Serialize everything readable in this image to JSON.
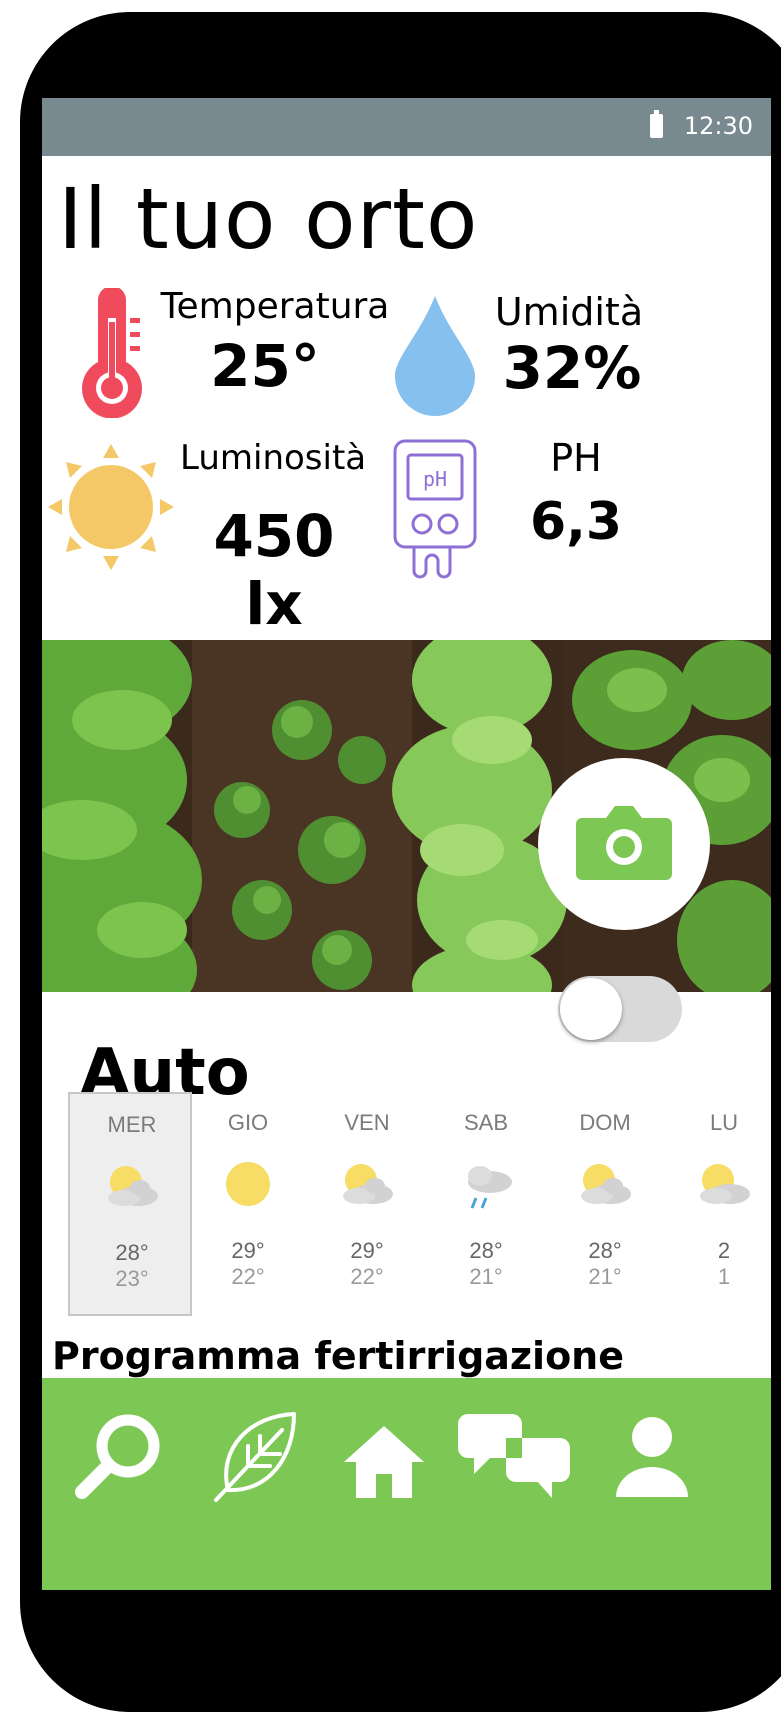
{
  "status_bar": {
    "time": "12:30"
  },
  "header": {
    "title": "Il tuo orto"
  },
  "metrics": {
    "temperature": {
      "label": "Temperatura",
      "value": "25°",
      "icon": "thermometer-icon",
      "color": "#ef4b5c"
    },
    "humidity": {
      "label": "Umidità",
      "value": "32%",
      "icon": "water-drop-icon",
      "color": "#85c0ee"
    },
    "light": {
      "label": "Luminosità",
      "value": "450 lx",
      "icon": "sun-icon",
      "color": "#f5c867"
    },
    "ph": {
      "label": "PH",
      "value": "6,3",
      "icon": "ph-meter-icon",
      "color": "#8e6fd6"
    }
  },
  "camera": {
    "icon": "camera-icon",
    "color": "#7dc855"
  },
  "auto": {
    "label": "Auto",
    "enabled": false
  },
  "forecast": [
    {
      "day": "MER",
      "icon": "partly-cloudy-icon",
      "high": "28°",
      "low": "23°",
      "selected": true
    },
    {
      "day": "GIO",
      "icon": "sunny-icon",
      "high": "29°",
      "low": "22°",
      "selected": false
    },
    {
      "day": "VEN",
      "icon": "partly-cloudy-icon",
      "high": "29°",
      "low": "22°",
      "selected": false
    },
    {
      "day": "SAB",
      "icon": "rain-icon",
      "high": "28°",
      "low": "21°",
      "selected": false
    },
    {
      "day": "DOM",
      "icon": "partly-cloudy-icon",
      "high": "28°",
      "low": "21°",
      "selected": false
    },
    {
      "day": "LU",
      "icon": "partly-cloudy-icon",
      "high": "2",
      "low": "1",
      "selected": false
    }
  ],
  "program": {
    "title": "Programma fertirrigazione"
  },
  "navbar": {
    "color": "#7dc855",
    "items": [
      {
        "icon": "search-icon"
      },
      {
        "icon": "leaf-icon"
      },
      {
        "icon": "home-icon"
      },
      {
        "icon": "chat-icon"
      },
      {
        "icon": "user-icon"
      }
    ]
  }
}
